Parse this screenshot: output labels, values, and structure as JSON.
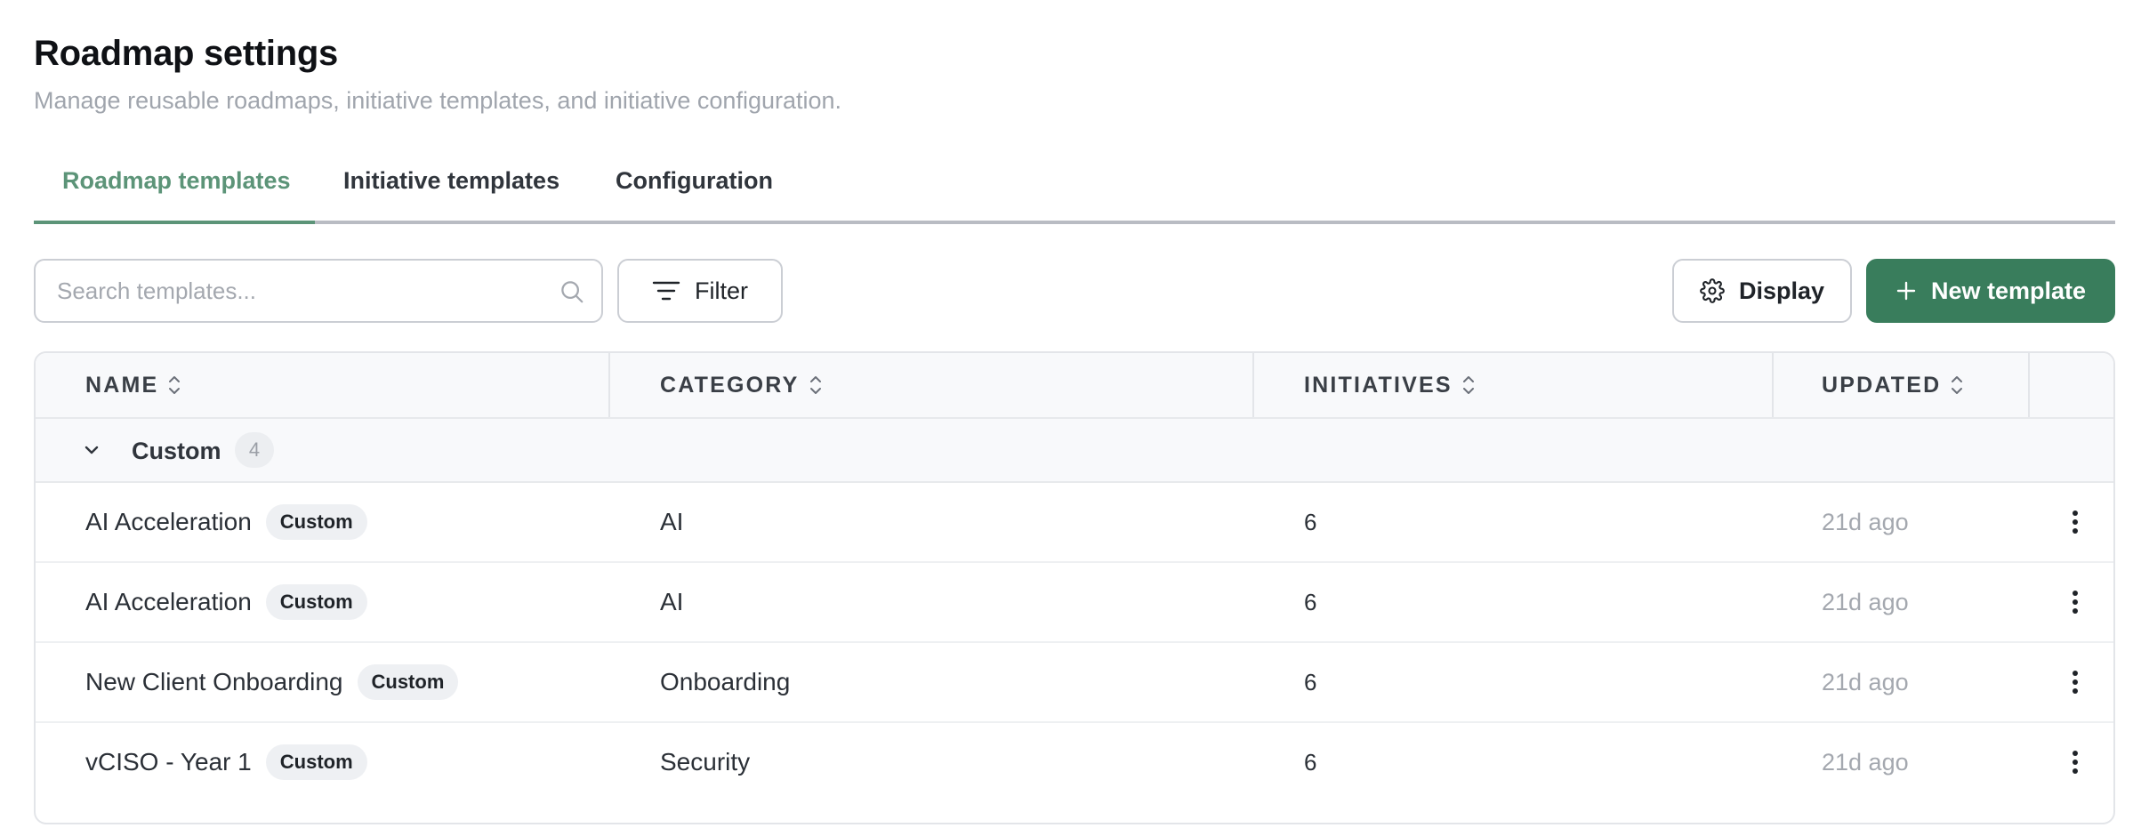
{
  "header": {
    "title": "Roadmap settings",
    "subtitle": "Manage reusable roadmaps, initiative templates, and initiative configuration."
  },
  "tabs": [
    {
      "label": "Roadmap templates",
      "active": true
    },
    {
      "label": "Initiative templates",
      "active": false
    },
    {
      "label": "Configuration",
      "active": false
    }
  ],
  "toolbar": {
    "search_placeholder": "Search templates...",
    "search_value": "",
    "filter_label": "Filter",
    "display_label": "Display",
    "new_label": "New template"
  },
  "table": {
    "columns": [
      "NAME",
      "CATEGORY",
      "INITIATIVES",
      "UPDATED"
    ],
    "group": {
      "label": "Custom",
      "count": "4",
      "expanded": true
    },
    "rows": [
      {
        "name": "AI Acceleration",
        "badge": "Custom",
        "category": "AI",
        "initiatives": "6",
        "updated": "21d ago"
      },
      {
        "name": "AI Acceleration",
        "badge": "Custom",
        "category": "AI",
        "initiatives": "6",
        "updated": "21d ago"
      },
      {
        "name": "New Client Onboarding",
        "badge": "Custom",
        "category": "Onboarding",
        "initiatives": "6",
        "updated": "21d ago"
      },
      {
        "name": "vCISO - Year 1",
        "badge": "Custom",
        "category": "Security",
        "initiatives": "6",
        "updated": "21d ago"
      }
    ]
  },
  "colors": {
    "accent": "#5c9478",
    "primary_button": "#397d5c",
    "muted_text": "#a4a8af"
  },
  "icons": {
    "search": "search-icon",
    "filter": "filter-icon",
    "display": "gear-icon",
    "new": "plus-icon",
    "sort": "sort-icon",
    "group_toggle": "chevron-down-icon",
    "row_menu": "more-vertical-icon"
  }
}
